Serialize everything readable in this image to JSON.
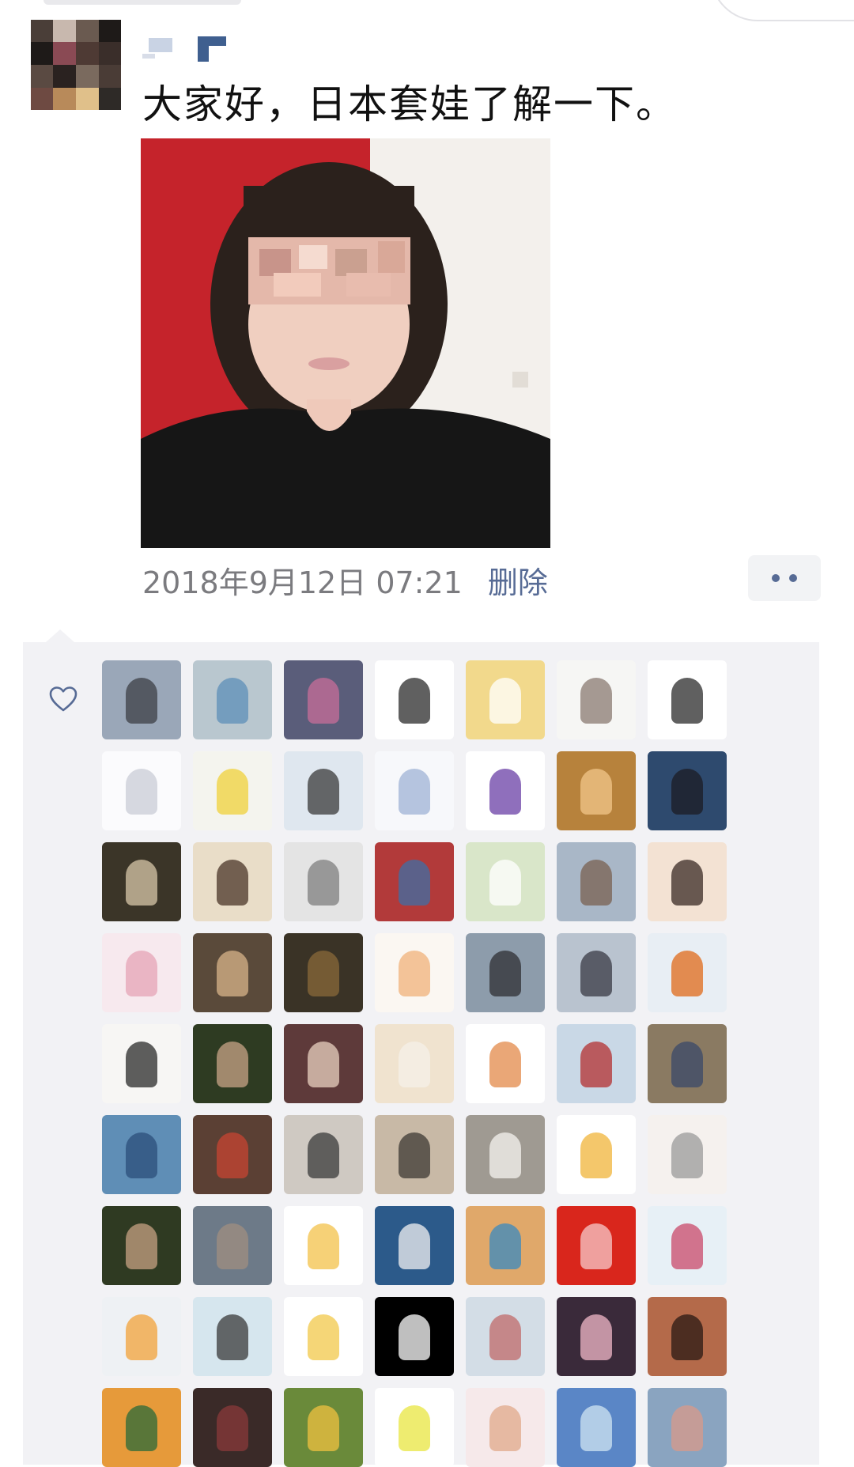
{
  "post": {
    "text": "大家好，日本套娃了解一下。",
    "timestamp": "2018年9月12日 07:21",
    "delete_label": "删除"
  },
  "icons": {
    "like": "heart-outline-icon",
    "more": "more-dots-icon"
  },
  "colors": {
    "link": "#576b95",
    "panel_bg": "#f2f2f5",
    "timestamp": "#7b7b7f"
  },
  "likers": [
    {
      "color": "#9aa7b8",
      "accent": "#3c3f46"
    },
    {
      "color": "#b9c7cf",
      "accent": "#5d8fb8"
    },
    {
      "color": "#5a5d7a",
      "accent": "#c86e9a"
    },
    {
      "color": "#ffffff",
      "accent": "#2b2b2b"
    },
    {
      "color": "#f2d98c",
      "accent": "#ffffff"
    },
    {
      "color": "#f6f6f4",
      "accent": "#8a7a72"
    },
    {
      "color": "#ffffff",
      "accent": "#2b2b2b"
    },
    {
      "color": "#fbfbfd",
      "accent": "#c9ccd6"
    },
    {
      "color": "#f4f4ee",
      "accent": "#f0d23a"
    },
    {
      "color": "#dfe7ef",
      "accent": "#3a3a3a"
    },
    {
      "color": "#f7f8fb",
      "accent": "#9fb3d6"
    },
    {
      "color": "#ffffff",
      "accent": "#6a3fa5"
    },
    {
      "color": "#b7823c",
      "accent": "#f2c58a"
    },
    {
      "color": "#2e4a6e",
      "accent": "#1c1c24"
    },
    {
      "color": "#3b3528",
      "accent": "#d8c7a8"
    },
    {
      "color": "#e9ddc8",
      "accent": "#4a3428"
    },
    {
      "color": "#e4e4e4",
      "accent": "#7f7f7f"
    },
    {
      "color": "#b23a3a",
      "accent": "#3e6fa5"
    },
    {
      "color": "#d9e6c9",
      "accent": "#ffffff"
    },
    {
      "color": "#a9b7c7",
      "accent": "#7a6050"
    },
    {
      "color": "#f3e2d3",
      "accent": "#3a2a24"
    },
    {
      "color": "#f7e9ee",
      "accent": "#e6a3b6"
    },
    {
      "color": "#5a4a3a",
      "accent": "#d8b48a"
    },
    {
      "color": "#3a3326",
      "accent": "#8a6a3a"
    },
    {
      "color": "#fbf7f2",
      "accent": "#f0b27a"
    },
    {
      "color": "#8d9cab",
      "accent": "#2f2f33"
    },
    {
      "color": "#b9c3cf",
      "accent": "#3a3a44"
    },
    {
      "color": "#e8eef4",
      "accent": "#e06a1a"
    },
    {
      "color": "#f7f6f4",
      "accent": "#2a2a2a"
    },
    {
      "color": "#2e3b22",
      "accent": "#c8a487"
    },
    {
      "color": "#5e3a3a",
      "accent": "#e9d2c0"
    },
    {
      "color": "#f0e3cf",
      "accent": "#f6f0e8"
    },
    {
      "color": "#ffffff",
      "accent": "#e38a4a"
    },
    {
      "color": "#c9d8e6",
      "accent": "#b33030"
    },
    {
      "color": "#8a7a62",
      "accent": "#3a4a6a"
    },
    {
      "color": "#5f8eb6",
      "accent": "#2b4e7a"
    },
    {
      "color": "#5b4034",
      "accent": "#c74431"
    },
    {
      "color": "#cfc9c2",
      "accent": "#3a3a3a"
    },
    {
      "color": "#c8b9a6",
      "accent": "#3d3a33"
    },
    {
      "color": "#9f9a92",
      "accent": "#f5f3ef"
    },
    {
      "color": "#ffffff",
      "accent": "#f0b43a"
    },
    {
      "color": "#f5f1ee",
      "accent": "#9a9a9a"
    },
    {
      "color": "#2f3a22",
      "accent": "#c7a283"
    },
    {
      "color": "#6d7a88",
      "accent": "#a08f80"
    },
    {
      "color": "#ffffff",
      "accent": "#f3c24a"
    },
    {
      "color": "#2c5a8a",
      "accent": "#f2f2f2"
    },
    {
      "color": "#e0a86a",
      "accent": "#3a8ac0"
    },
    {
      "color": "#d9261c",
      "accent": "#f5c9c9"
    },
    {
      "color": "#e7f0f6",
      "accent": "#c94a6a"
    },
    {
      "color": "#eef1f4",
      "accent": "#f2a23a"
    },
    {
      "color": "#d6e6ee",
      "accent": "#3a3a3a"
    },
    {
      "color": "#ffffff",
      "accent": "#f2c84a"
    },
    {
      "color": "#000000",
      "accent": "#ffffff"
    },
    {
      "color": "#d3dde6",
      "accent": "#c06a6a"
    },
    {
      "color": "#3a2a3a",
      "accent": "#f2b8c8"
    },
    {
      "color": "#b46a4a",
      "accent": "#2a1a14"
    },
    {
      "color": "#e69a3a",
      "accent": "#2a6a3a"
    },
    {
      "color": "#3a2a28",
      "accent": "#8a3a3a"
    },
    {
      "color": "#6a8a3a",
      "accent": "#f0c040"
    },
    {
      "color": "#ffffff",
      "accent": "#e8e640"
    },
    {
      "color": "#f6e9ea",
      "accent": "#e0a88a"
    },
    {
      "color": "#5a86c6",
      "accent": "#d0e4f2"
    },
    {
      "color": "#8aa4c0",
      "accent": "#d89a8a"
    }
  ]
}
